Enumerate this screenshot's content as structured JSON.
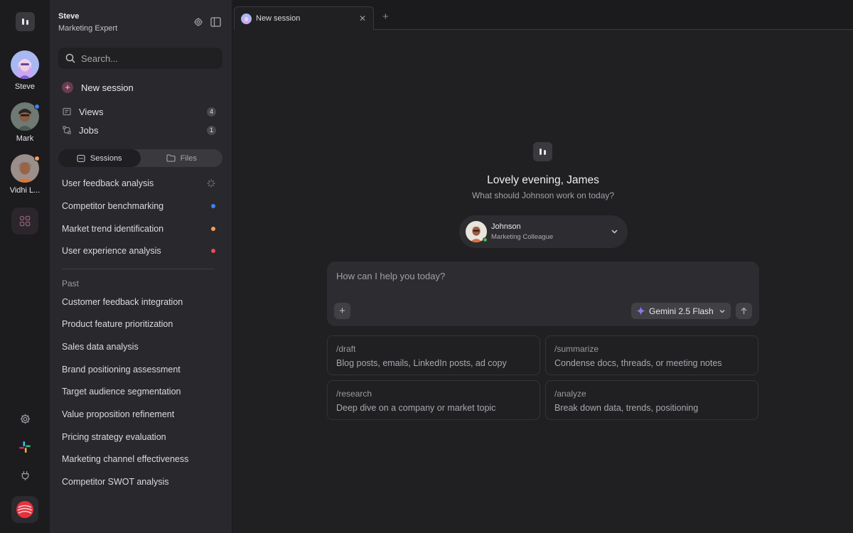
{
  "rail": {
    "agents": [
      {
        "name": "Steve",
        "status": ""
      },
      {
        "name": "Mark",
        "status": "#3b82f6"
      },
      {
        "name": "Vidhi L...",
        "status": "#f59e5b"
      }
    ]
  },
  "sidebar": {
    "user_name": "Steve",
    "user_role": "Marketing Expert",
    "search_placeholder": "Search...",
    "new_session_label": "New session",
    "nav": [
      {
        "label": "Views",
        "count": "4"
      },
      {
        "label": "Jobs",
        "count": "1"
      }
    ],
    "tabs": {
      "sessions": "Sessions",
      "files": "Files"
    },
    "active_sessions": [
      {
        "title": "User feedback analysis",
        "status": "loading"
      },
      {
        "title": "Competitor benchmarking",
        "status": "#3b82f6"
      },
      {
        "title": "Market trend identification",
        "status": "#f59e5b"
      },
      {
        "title": "User experience analysis",
        "status": "#e04e5a"
      }
    ],
    "past_label": "Past",
    "past_sessions": [
      "Customer feedback integration",
      "Product feature prioritization",
      "Sales data analysis",
      "Brand positioning assessment",
      "Target audience segmentation",
      "Value proposition refinement",
      "Pricing strategy evaluation",
      "Marketing channel effectiveness",
      "Competitor SWOT analysis"
    ]
  },
  "tabs": [
    {
      "label": "New session"
    }
  ],
  "main": {
    "greeting": "Lovely evening, James",
    "subtitle": "What should Johnson work on today?",
    "agent": {
      "name": "Johnson",
      "role": "Marketing Colleague"
    },
    "composer_placeholder": "How can I help you today?",
    "model_label": "Gemini 2.5 Flash",
    "suggestions": [
      {
        "command": "/draft",
        "description": "Blog posts, emails, LinkedIn posts, ad copy"
      },
      {
        "command": "/summarize",
        "description": "Condense docs, threads, or meeting notes"
      },
      {
        "command": "/research",
        "description": "Deep dive on a company or market topic"
      },
      {
        "command": "/analyze",
        "description": "Break down data, trends, positioning"
      }
    ]
  },
  "icons": {
    "app_logo": "app-logo-icon",
    "apps": "apps-grid-icon",
    "settings": "gear-icon",
    "slack": "slack-icon",
    "plug": "plug-icon",
    "brand": "brand-icon"
  }
}
